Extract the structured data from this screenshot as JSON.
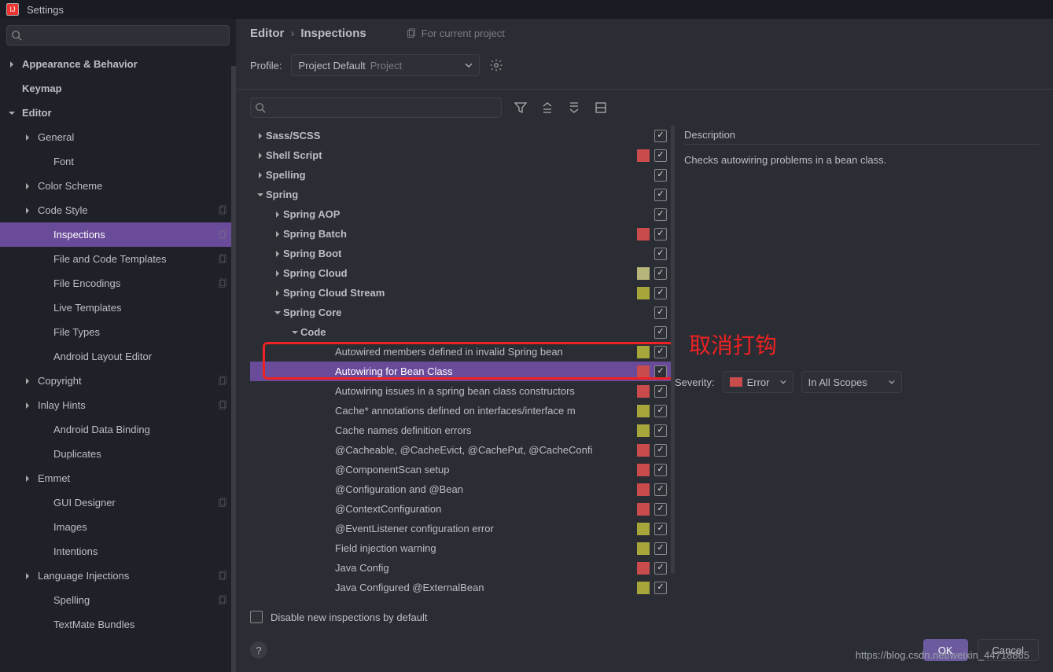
{
  "title": "Settings",
  "sidebar": {
    "search_placeholder": "",
    "items": [
      {
        "label": "Appearance & Behavior",
        "indent": 0,
        "arrow": "right",
        "bold": true
      },
      {
        "label": "Keymap",
        "indent": 0,
        "bold": true
      },
      {
        "label": "Editor",
        "indent": 0,
        "arrow": "down",
        "bold": true
      },
      {
        "label": "General",
        "indent": 1,
        "arrow": "right"
      },
      {
        "label": "Font",
        "indent": 2
      },
      {
        "label": "Color Scheme",
        "indent": 1,
        "arrow": "right"
      },
      {
        "label": "Code Style",
        "indent": 1,
        "arrow": "right",
        "copy": true
      },
      {
        "label": "Inspections",
        "indent": 2,
        "selected": true,
        "copy": true
      },
      {
        "label": "File and Code Templates",
        "indent": 2,
        "copy": true
      },
      {
        "label": "File Encodings",
        "indent": 2,
        "copy": true
      },
      {
        "label": "Live Templates",
        "indent": 2
      },
      {
        "label": "File Types",
        "indent": 2
      },
      {
        "label": "Android Layout Editor",
        "indent": 2
      },
      {
        "label": "Copyright",
        "indent": 1,
        "arrow": "right",
        "copy": true
      },
      {
        "label": "Inlay Hints",
        "indent": 1,
        "arrow": "right",
        "copy": true
      },
      {
        "label": "Android Data Binding",
        "indent": 2
      },
      {
        "label": "Duplicates",
        "indent": 2
      },
      {
        "label": "Emmet",
        "indent": 1,
        "arrow": "right"
      },
      {
        "label": "GUI Designer",
        "indent": 2,
        "copy": true
      },
      {
        "label": "Images",
        "indent": 2
      },
      {
        "label": "Intentions",
        "indent": 2
      },
      {
        "label": "Language Injections",
        "indent": 1,
        "arrow": "right",
        "copy": true
      },
      {
        "label": "Spelling",
        "indent": 2,
        "copy": true
      },
      {
        "label": "TextMate Bundles",
        "indent": 2
      }
    ]
  },
  "breadcrumb": {
    "a": "Editor",
    "b": "Inspections"
  },
  "header_sub": "For current project",
  "profile_label": "Profile:",
  "profile_value": "Project Default",
  "profile_ghost": "Project",
  "inspections": [
    {
      "label": "Sass/SCSS",
      "indent": 0,
      "arrow": "right",
      "bold": true,
      "cb": true
    },
    {
      "label": "Shell Script",
      "indent": 0,
      "arrow": "right",
      "bold": true,
      "sq": "red",
      "cb": true
    },
    {
      "label": "Spelling",
      "indent": 0,
      "arrow": "right",
      "bold": true,
      "cb": true
    },
    {
      "label": "Spring",
      "indent": 0,
      "arrow": "down",
      "bold": true,
      "cb": true
    },
    {
      "label": "Spring AOP",
      "indent": 1,
      "arrow": "right",
      "bold": true,
      "cb": true
    },
    {
      "label": "Spring Batch",
      "indent": 1,
      "arrow": "right",
      "bold": true,
      "sq": "red",
      "cb": true
    },
    {
      "label": "Spring Boot",
      "indent": 1,
      "arrow": "right",
      "bold": true,
      "cb": true
    },
    {
      "label": "Spring Cloud",
      "indent": 1,
      "arrow": "right",
      "bold": true,
      "sq": "tan",
      "cb": true
    },
    {
      "label": "Spring Cloud Stream",
      "indent": 1,
      "arrow": "right",
      "bold": true,
      "sq": "yellow",
      "cb": true
    },
    {
      "label": "Spring Core",
      "indent": 1,
      "arrow": "down",
      "bold": true,
      "cb": true
    },
    {
      "label": "Code",
      "indent": 2,
      "arrow": "down",
      "bold": true,
      "cb": true
    },
    {
      "label": "Autowired members defined in invalid Spring bean",
      "indent": 4,
      "sq": "yellow",
      "cb": true
    },
    {
      "label": "Autowiring for Bean Class",
      "indent": 4,
      "sq": "red",
      "cb": true,
      "selected": true
    },
    {
      "label": "Autowiring issues in a spring bean class constructors",
      "indent": 4,
      "sq": "red",
      "cb": true
    },
    {
      "label": "Cache* annotations defined on interfaces/interface m",
      "indent": 4,
      "sq": "yellow",
      "cb": true
    },
    {
      "label": "Cache names definition errors",
      "indent": 4,
      "sq": "yellow",
      "cb": true
    },
    {
      "label": "@Cacheable, @CacheEvict, @CachePut, @CacheConfi",
      "indent": 4,
      "sq": "red",
      "cb": true
    },
    {
      "label": "@ComponentScan setup",
      "indent": 4,
      "sq": "red",
      "cb": true
    },
    {
      "label": "@Configuration and @Bean",
      "indent": 4,
      "sq": "red",
      "cb": true
    },
    {
      "label": "@ContextConfiguration",
      "indent": 4,
      "sq": "red",
      "cb": true
    },
    {
      "label": "@EventListener configuration error",
      "indent": 4,
      "sq": "yellow",
      "cb": true
    },
    {
      "label": "Field injection warning",
      "indent": 4,
      "sq": "yellow",
      "cb": true
    },
    {
      "label": "Java Config",
      "indent": 4,
      "sq": "red",
      "cb": true
    },
    {
      "label": "Java Configured @ExternalBean",
      "indent": 4,
      "sq": "yellow",
      "cb": true
    }
  ],
  "description_header": "Description",
  "description_text": "Checks autowiring problems in a bean class.",
  "annotation": "取消打钩",
  "severity_label": "Severity:",
  "severity_value": "Error",
  "scopes_value": "In All Scopes",
  "disable_new": "Disable new inspections by default",
  "ok": "OK",
  "cancel": "Cancel",
  "url": "https://blog.csdn.net/weixin_44718865"
}
